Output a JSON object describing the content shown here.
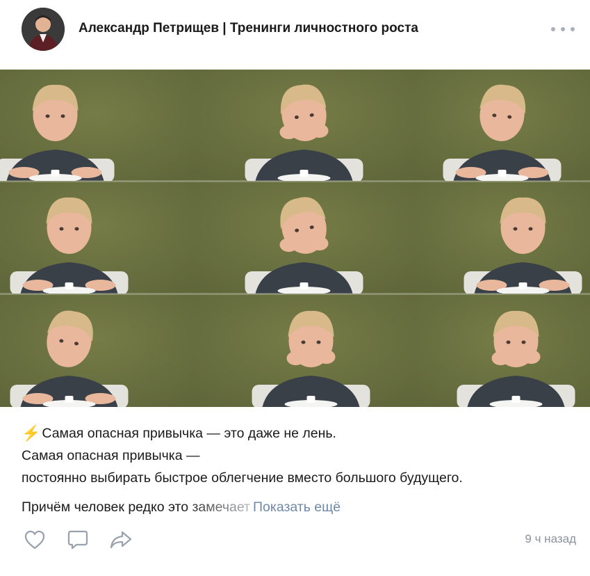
{
  "header": {
    "author": "Александр Петрищев | Тренинги личностного роста",
    "avatar_icon": "user-avatar-photo",
    "menu_icon": "more-dots-icon"
  },
  "post": {
    "image_alt": "Коллаж из девяти кадров: мальчик за столом перед тарелкой с маршмеллоу",
    "colors": {
      "backdrop": "#6a7140",
      "hair": "#d8b98a",
      "skin": "#e9b89c",
      "shirt": "#3a4047",
      "chair": "#e4e2dc"
    },
    "line1": "Самая опасная привычка — это даже не лень.",
    "line2": "Самая опасная привычка —",
    "line3": "постоянно выбирать быстрое облегчение вместо большого будущего.",
    "line4": "Причём человек редко это замечает",
    "show_more": "Показать ещё",
    "bolt": "⚡"
  },
  "footer": {
    "like_icon": "heart-icon",
    "comment_icon": "comment-icon",
    "share_icon": "share-icon",
    "time": "9 ч назад"
  },
  "colors": {
    "accent_link": "#6f88a8",
    "icon_gray": "#a8b0ba",
    "muted_text": "#8a929b"
  }
}
